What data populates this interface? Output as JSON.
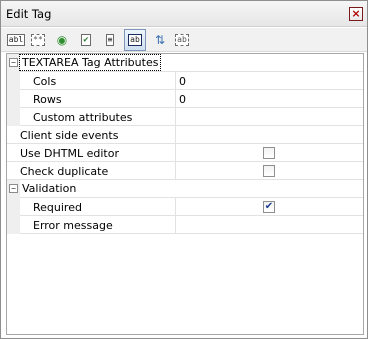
{
  "window": {
    "title": "Edit Tag",
    "close_glyph": "×"
  },
  "toolbar": [
    {
      "name": "textbox-icon",
      "glyph": "abl"
    },
    {
      "name": "password-field-icon",
      "glyph": "**"
    },
    {
      "name": "radio-button-icon",
      "glyph": "◉"
    },
    {
      "name": "checkbox-icon",
      "glyph": "✔"
    },
    {
      "name": "select-list-icon",
      "glyph": "≡"
    },
    {
      "name": "textarea-icon",
      "glyph": "ab",
      "active": true
    },
    {
      "name": "hidden-field-icon",
      "glyph": "⇅"
    },
    {
      "name": "label-icon",
      "glyph": "ab"
    }
  ],
  "properties": {
    "group_textarea": {
      "label": "TEXTAREA Tag Attributes",
      "toggle": "−"
    },
    "cols": {
      "label": "Cols",
      "value": "0"
    },
    "rows": {
      "label": "Rows",
      "value": "0"
    },
    "custom_attributes": {
      "label": "Custom attributes",
      "value": ""
    },
    "client_side_events": {
      "label": "Client side events",
      "value": ""
    },
    "use_dhtml_editor": {
      "label": "Use DHTML editor",
      "checked": false
    },
    "check_duplicate": {
      "label": "Check duplicate",
      "checked": false
    },
    "group_validation": {
      "label": "Validation",
      "toggle": "−"
    },
    "required": {
      "label": "Required",
      "checked": true,
      "check_glyph": "✔"
    },
    "error_message": {
      "label": "Error message",
      "value": ""
    }
  }
}
